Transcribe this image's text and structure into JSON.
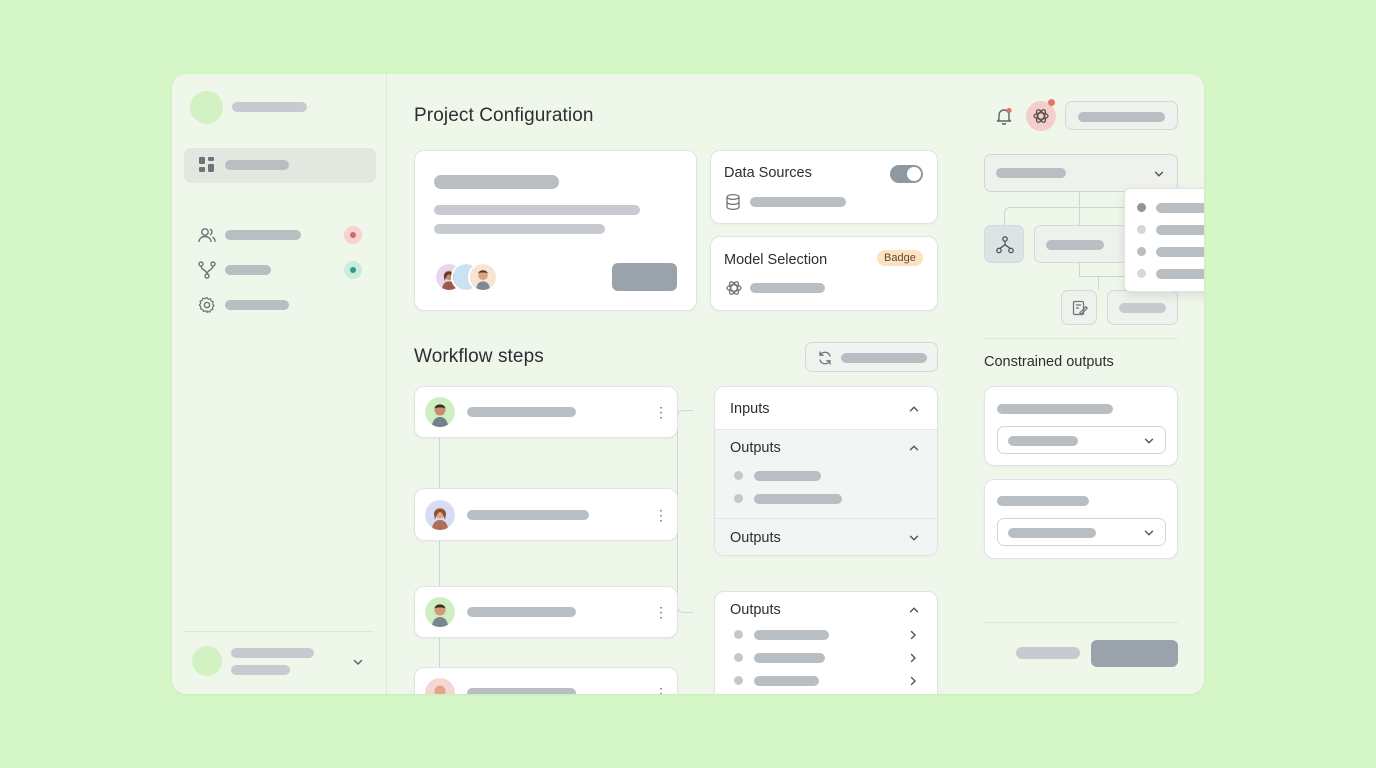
{
  "main": {
    "project_title": "Project Configuration",
    "data_sources": {
      "title": "Data Sources",
      "toggle_on": true
    },
    "model_selection": {
      "title": "Model Selection",
      "badge": "Badge"
    },
    "workflow_title": "Workflow steps",
    "accordion_a": {
      "inputs_label": "Inputs",
      "outputs_label": "Outputs",
      "outputs2_label": "Outputs"
    },
    "accordion_b": {
      "outputs_label": "Outputs"
    }
  },
  "right": {
    "constrained_title": "Constrained outputs"
  },
  "colors": {
    "page_bg": "#d5f6c6",
    "app_bg": "#eff7ea",
    "skeleton": "#b9bec2",
    "badge_bg": "#fbe3c2",
    "notify_red": "#cf6a64",
    "teal": "#2f9c85"
  },
  "icons": [
    "dashboard-icon",
    "users-icon",
    "branch-icon",
    "gear-icon",
    "database-icon",
    "openai-icon",
    "refresh-icon",
    "bell-icon",
    "hierarchy-icon",
    "edit-doc-icon",
    "chevron-down-icon",
    "chevron-up-icon",
    "chevron-right-icon",
    "kebab-icon"
  ]
}
